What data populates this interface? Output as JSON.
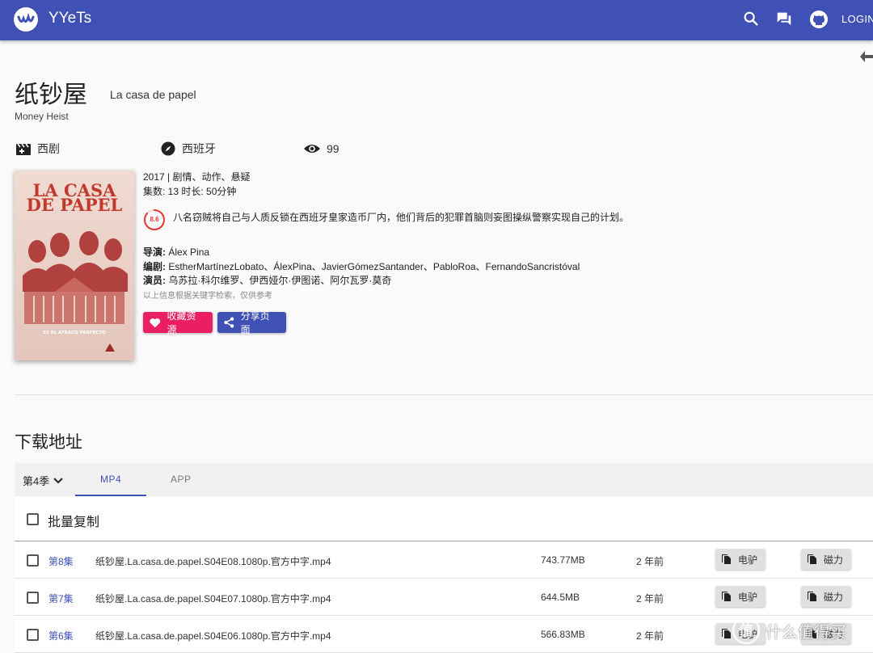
{
  "header": {
    "app_title": "YYeTs",
    "login_label": "LOGIN",
    "icons": [
      "search-icon",
      "forum-icon",
      "github-icon"
    ]
  },
  "show": {
    "cn_title": "纸钞屋",
    "original_title": "La casa de papel",
    "en_title": "Money Heist",
    "category": "西剧",
    "region": "西班牙",
    "views": "99",
    "year_genres": "2017 | 剧情、动作、悬疑",
    "episodes_duration": "集数: 13 时长: 50分钟",
    "rating": "8.6",
    "rating_fraction": 0.86,
    "description": "八名窃贼将自己与人质反锁在西班牙皇家造币厂内，他们背后的犯罪首脑则妄图操纵警察实现自己的计划。",
    "director_label": "导演:",
    "director": "Álex Pina",
    "writers_label": "编剧:",
    "writers": "EstherMartínezLobato、ÁlexPina、JavierGómezSantander、PabloRoa、FernandoSancristóval",
    "cast_label": "演员:",
    "cast": "乌苏拉·科尔维罗、伊西娅尔·伊图诺、阿尔瓦罗·莫奇",
    "note": "以上信息根据关键字检索，仅供参考",
    "poster_text": {
      "title_line1": "LA CASA",
      "title_line2": "DE PAPEL",
      "tagline": "ES EL ATRACO PERFECTO"
    }
  },
  "actions": {
    "favorite_label": "收藏资源",
    "share_label": "分享页面"
  },
  "downloads": {
    "section_title": "下载地址",
    "season_label": "第4季",
    "tabs": [
      "MP4",
      "APP"
    ],
    "active_tab": "MP4",
    "batch_copy_label": "批量复制",
    "ed2k_label": "电驴",
    "magnet_label": "磁力",
    "rows": [
      {
        "episode": "第8集",
        "filename": "纸钞屋.La.casa.de.papel.S04E08.1080p.官方中字.mp4",
        "size": "743.77MB",
        "date": "2 年前"
      },
      {
        "episode": "第7集",
        "filename": "纸钞屋.La.casa.de.papel.S04E07.1080p.官方中字.mp4",
        "size": "644.5MB",
        "date": "2 年前"
      },
      {
        "episode": "第6集",
        "filename": "纸钞屋.La.casa.de.papel.S04E06.1080p.官方中字.mp4",
        "size": "566.83MB",
        "date": "2 年前"
      }
    ]
  },
  "watermark": {
    "text": "什么值得买",
    "icon": "smzdm-logo-icon"
  },
  "colors": {
    "primary": "#3f51b5",
    "accent": "#e91e63",
    "rating": "#e53935"
  }
}
